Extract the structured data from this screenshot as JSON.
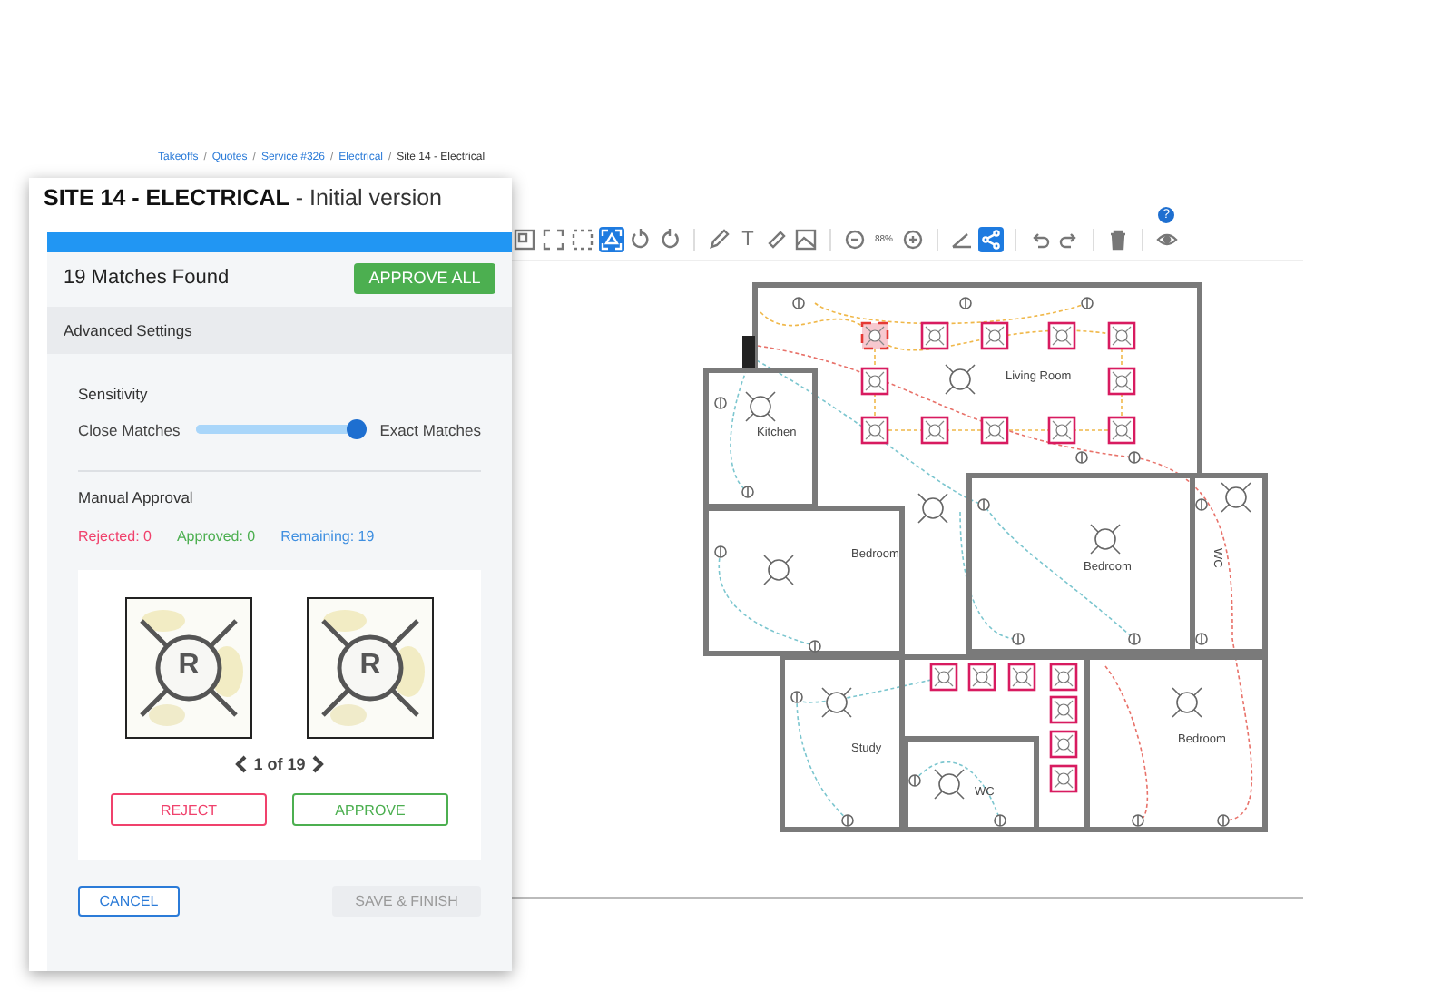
{
  "breadcrumb": {
    "separator": "/",
    "items": [
      {
        "label": "Takeoffs",
        "kind": "link"
      },
      {
        "label": "Quotes",
        "kind": "link"
      },
      {
        "label": "Service #326",
        "kind": "link"
      },
      {
        "label": "Electrical",
        "kind": "link"
      },
      {
        "label": "Site 14 - Electrical",
        "kind": "current"
      }
    ]
  },
  "toolbar": [
    {
      "kind": "frame",
      "selected": false
    },
    {
      "kind": "fullscreen",
      "selected": false
    },
    {
      "kind": "dashed-box",
      "selected": false
    },
    {
      "kind": "detect",
      "selected": true
    },
    {
      "kind": "rotate-left",
      "selected": false
    },
    {
      "kind": "rotate-right",
      "selected": false
    },
    {
      "kind": "divider"
    },
    {
      "kind": "pencil",
      "selected": false
    },
    {
      "kind": "text",
      "label": "T",
      "selected": false
    },
    {
      "kind": "ruler",
      "selected": false
    },
    {
      "kind": "image",
      "selected": false
    },
    {
      "kind": "divider"
    },
    {
      "kind": "zoom-out",
      "selected": false
    },
    {
      "kind": "zoom-level",
      "label": "88%"
    },
    {
      "kind": "zoom-in",
      "selected": false
    },
    {
      "kind": "divider"
    },
    {
      "kind": "angle",
      "selected": false
    },
    {
      "kind": "share",
      "selected": true
    },
    {
      "kind": "divider"
    },
    {
      "kind": "undo",
      "selected": false
    },
    {
      "kind": "redo",
      "selected": false
    },
    {
      "kind": "divider"
    },
    {
      "kind": "trash",
      "selected": false
    },
    {
      "kind": "divider"
    },
    {
      "kind": "eye",
      "selected": false,
      "badge": "?"
    }
  ],
  "floor_plan": {
    "rooms": [
      "Living Room",
      "Kitchen",
      "Bedroom",
      "Bedroom",
      "WC",
      "Study",
      "WC",
      "Bedroom"
    ],
    "matches": [
      {
        "selected": true
      },
      {
        "selected": false
      },
      {
        "selected": false
      },
      {
        "selected": false
      },
      {
        "selected": false
      },
      {
        "selected": false
      },
      {
        "selected": false
      },
      {
        "selected": false
      },
      {
        "selected": false
      },
      {
        "selected": false
      },
      {
        "selected": false
      },
      {
        "selected": false
      },
      {
        "selected": false
      },
      {
        "selected": false
      },
      {
        "selected": false
      },
      {
        "selected": false
      },
      {
        "selected": false
      },
      {
        "selected": false
      },
      {
        "selected": false
      }
    ]
  },
  "panel": {
    "title": "**SITE 14 - ELECTRICAL** - Initial version",
    "progress": {
      "level": 1
    },
    "matches_found": "19 Matches Found",
    "approve_all": "APPROVE ALL",
    "advanced_settings": "Advanced Settings",
    "sensitivity": {
      "title": "Sensitivity",
      "min_label": "Close Matches",
      "max_label": "Exact Matches",
      "level": 0.97
    },
    "manual_approval": {
      "title": "Manual Approval",
      "counts": [
        {
          "label": "Rejected: 0",
          "color": "#f0416c"
        },
        {
          "label": "Approved: 0",
          "color": "#4caf50"
        },
        {
          "label": "Remaining: 19",
          "color": "#3f8fe0"
        }
      ]
    },
    "thumbnails": [
      {
        "letter": "R"
      },
      {
        "letter": "R"
      }
    ],
    "pager": "1 of 19",
    "reject": "REJECT",
    "approve": "APPROVE",
    "cancel": "CANCEL",
    "save": {
      "label": "SAVE & FINISH",
      "disabled": true
    }
  }
}
